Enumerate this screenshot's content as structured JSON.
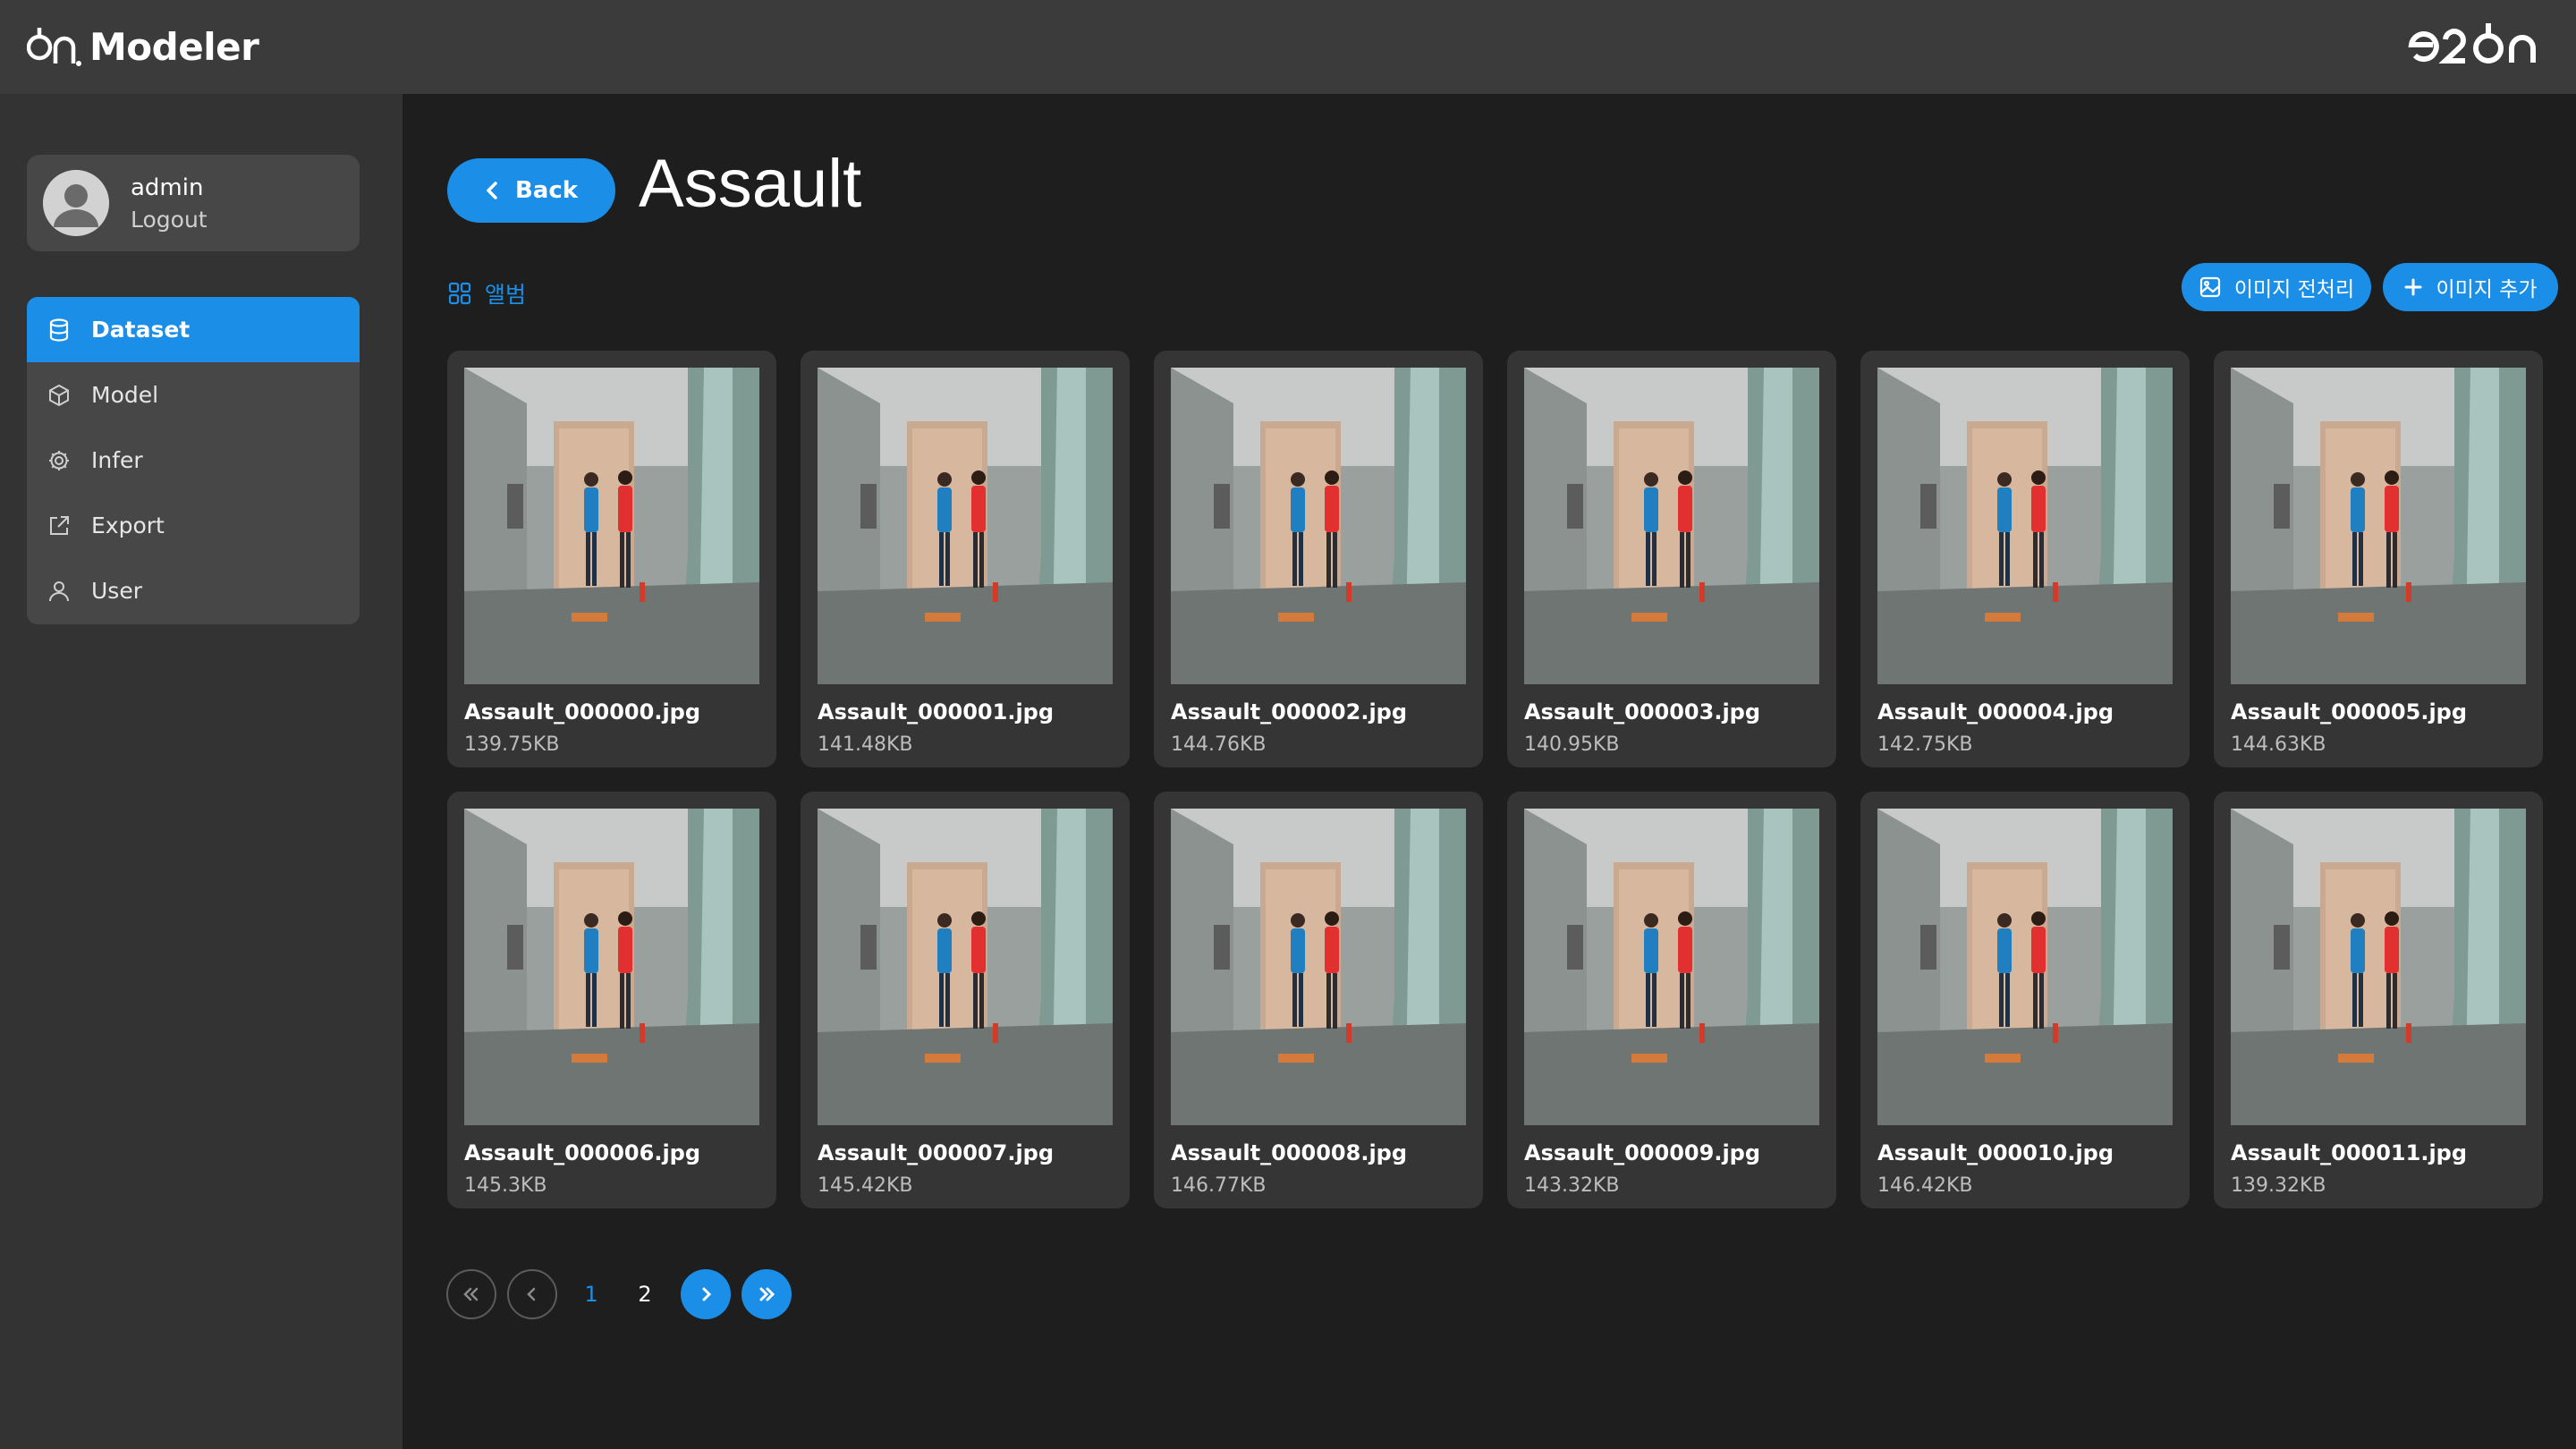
{
  "header": {
    "app_name": "Modeler",
    "brand_logo": "e2on-logo",
    "colors": {
      "topbar": "#3b3b3b",
      "accent": "#1b8fe8",
      "background": "#1e1e1e",
      "sidebar": "#333333"
    }
  },
  "user": {
    "name": "admin",
    "logout_label": "Logout",
    "avatar_icon": "user-avatar-icon"
  },
  "sidebar": {
    "items": [
      {
        "label": "Dataset",
        "icon": "database-icon",
        "active": true
      },
      {
        "label": "Model",
        "icon": "cube-icon",
        "active": false
      },
      {
        "label": "Infer",
        "icon": "gear-icon",
        "active": false
      },
      {
        "label": "Export",
        "icon": "export-icon",
        "active": false
      },
      {
        "label": "User",
        "icon": "user-icon",
        "active": false
      }
    ]
  },
  "main": {
    "back_label": "Back",
    "title": "Assault",
    "view_label": "앨범",
    "preprocess_label": "이미지 전처리",
    "add_label": "이미지 추가"
  },
  "images": [
    {
      "name": "Assault_000000.jpg",
      "size": "139.75KB"
    },
    {
      "name": "Assault_000001.jpg",
      "size": "141.48KB"
    },
    {
      "name": "Assault_000002.jpg",
      "size": "144.76KB"
    },
    {
      "name": "Assault_000003.jpg",
      "size": "140.95KB"
    },
    {
      "name": "Assault_000004.jpg",
      "size": "142.75KB"
    },
    {
      "name": "Assault_000005.jpg",
      "size": "144.63KB"
    },
    {
      "name": "Assault_000006.jpg",
      "size": "145.3KB"
    },
    {
      "name": "Assault_000007.jpg",
      "size": "145.42KB"
    },
    {
      "name": "Assault_000008.jpg",
      "size": "146.77KB"
    },
    {
      "name": "Assault_000009.jpg",
      "size": "143.32KB"
    },
    {
      "name": "Assault_000010.jpg",
      "size": "146.42KB"
    },
    {
      "name": "Assault_000011.jpg",
      "size": "139.32KB"
    }
  ],
  "pagination": {
    "pages": [
      "1",
      "2"
    ],
    "current": "1"
  }
}
